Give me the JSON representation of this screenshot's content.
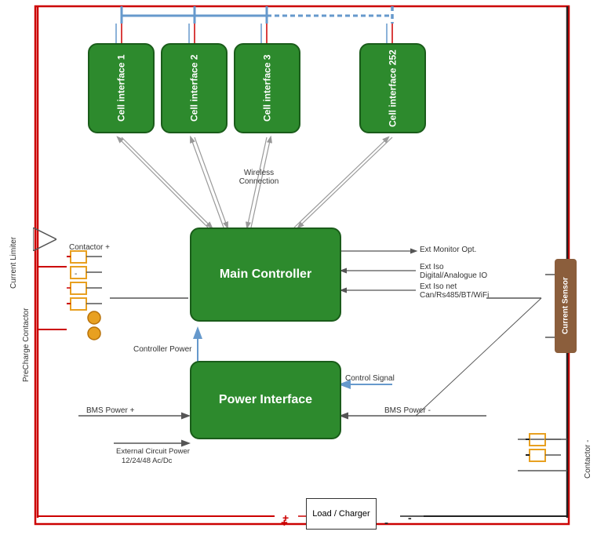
{
  "cells": [
    {
      "id": "cell1",
      "label": "Cell interface 1"
    },
    {
      "id": "cell2",
      "label": "Cell interface 2"
    },
    {
      "id": "cell3",
      "label": "Cell interface 3"
    },
    {
      "id": "cell252",
      "label": "Cell interface 252"
    }
  ],
  "mainController": {
    "label": "Main Controller"
  },
  "powerInterface": {
    "label": "Power Interface"
  },
  "currentSensor": {
    "label": "Current Sensor"
  },
  "currentLimiter": {
    "label": "Current Limiter"
  },
  "preChargeContactor": {
    "label": "PreCharge Contactor"
  },
  "contactorPlus": {
    "label": "Contactor +"
  },
  "contactorMinus": {
    "label": "Contactor -"
  },
  "labels": {
    "wirelessConnection": "Wireless\nConnection",
    "extMonitorOpt": "Ext Monitor Opt.",
    "extIsoDigital": "Ext Iso\nDigital/Analogue IO",
    "extIsoNet": "Ext Iso net\nCan/Rs485/BT/WiFi",
    "controllerPower": "Controller Power",
    "controlSignal": "Control Signal",
    "bmsPowerPlus": "BMS Power +",
    "bmsPowerMinus": "BMS Power -",
    "externalCircuitPower": "External Circuit Power\n12/24/48 Ac/Dc",
    "loadCharger": "Load /\nCharger",
    "plus": "+",
    "minus": "-"
  }
}
